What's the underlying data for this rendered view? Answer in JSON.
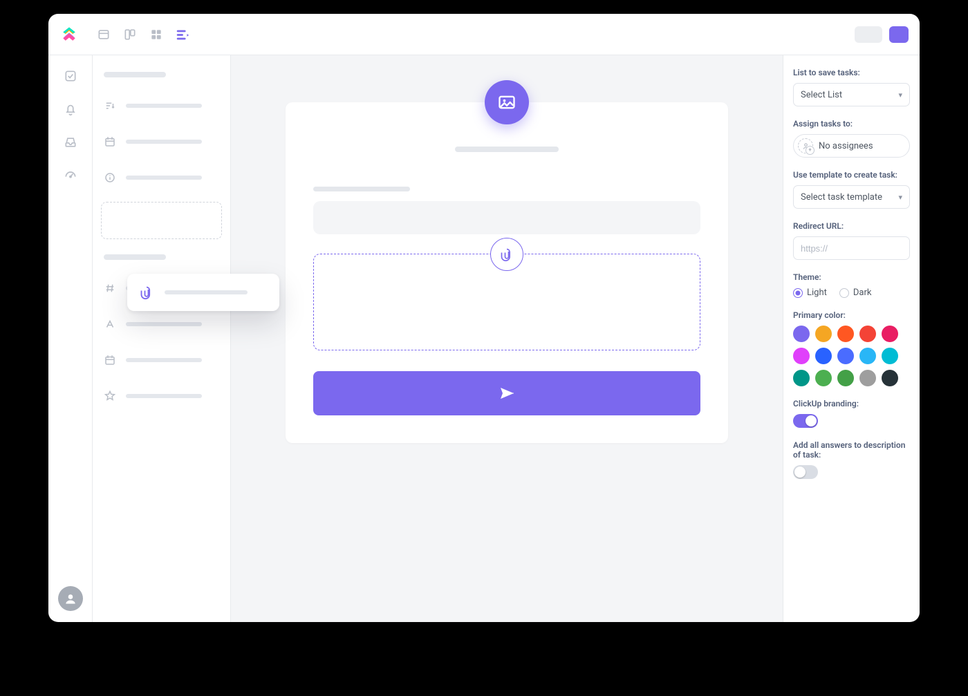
{
  "colors": {
    "primary": "#7b68ee",
    "swatches": [
      "#7b68ee",
      "#f5a623",
      "#ff5722",
      "#f44336",
      "#e91e63",
      "#e040fb",
      "#2962ff",
      "#4a6cff",
      "#29b6f6",
      "#00bcd4",
      "#009688",
      "#4caf50",
      "#43a047",
      "#9e9e9e",
      "#263238"
    ]
  },
  "rightPanel": {
    "listLabel": "List to save tasks:",
    "listValue": "Select List",
    "assignLabel": "Assign tasks to:",
    "assignValue": "No assignees",
    "templateLabel": "Use template to create task:",
    "templateValue": "Select task template",
    "redirectLabel": "Redirect URL:",
    "redirectPlaceholder": "https://",
    "themeLabel": "Theme:",
    "themeLight": "Light",
    "themeDark": "Dark",
    "themeSelected": "light",
    "primaryColorLabel": "Primary color:",
    "brandingLabel": "ClickUp branding:",
    "brandingOn": true,
    "answersLabel": "Add all answers to description of task:",
    "answersOn": false
  }
}
